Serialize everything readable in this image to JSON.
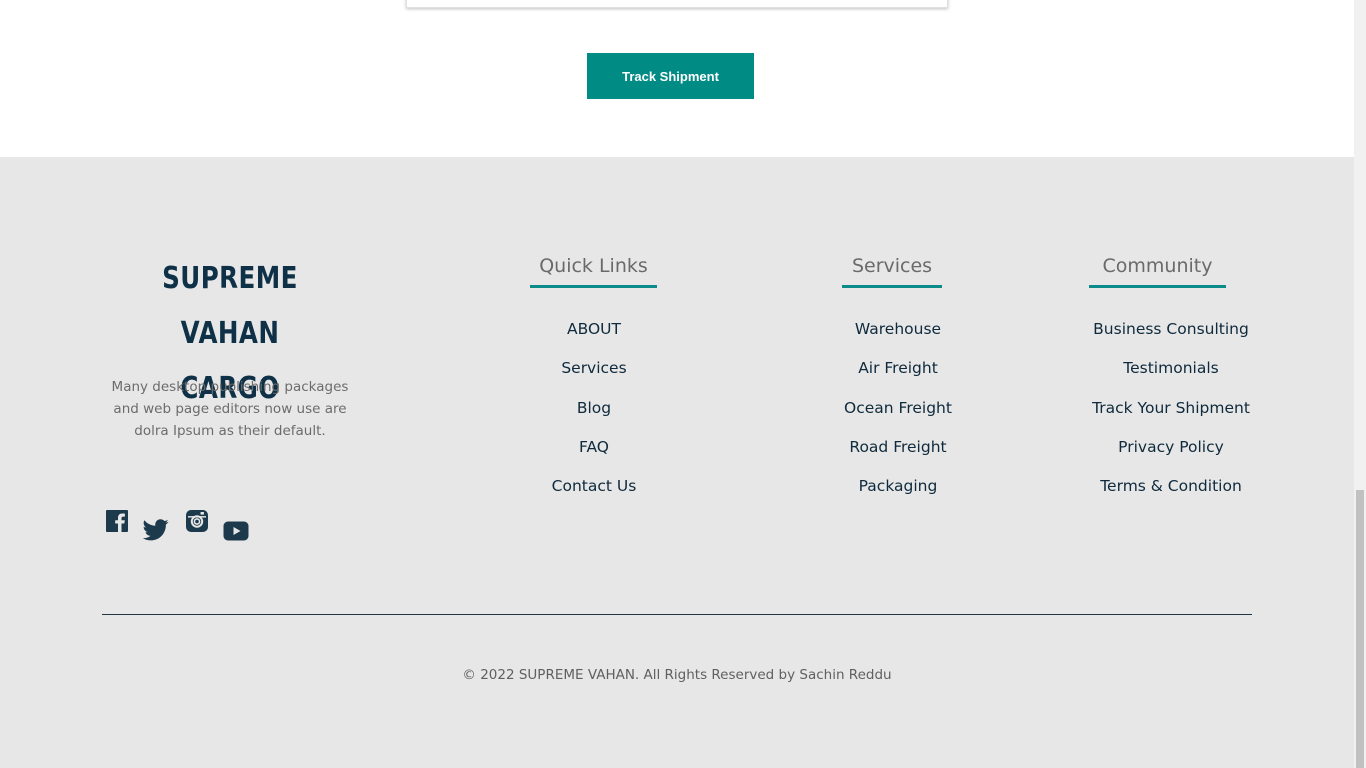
{
  "tracking": {
    "button_label": "Track Shipment"
  },
  "brand": {
    "name_line1": "SUPREME VAHAN",
    "name_line2": "CARGO",
    "description": "Many desktop publishing packages and web page editors now use are dolra Ipsum as their default."
  },
  "social": [
    {
      "icon": "facebook-icon"
    },
    {
      "icon": "twitter-icon"
    },
    {
      "icon": "instagram-icon"
    },
    {
      "icon": "youtube-icon"
    }
  ],
  "quick_links": {
    "heading": "Quick Links",
    "items": [
      "ABOUT",
      "Services",
      "Blog",
      "FAQ",
      "Contact Us"
    ]
  },
  "services": {
    "heading": "Services",
    "items": [
      "Warehouse",
      "Air Freight",
      "Ocean Freight",
      "Road Freight",
      "Packaging"
    ]
  },
  "community": {
    "heading": "Community",
    "items": [
      "Business Consulting",
      "Testimonials",
      "Track Your Shipment",
      "Privacy Policy",
      "Terms & Condition"
    ]
  },
  "footer": {
    "copyright": "© 2022 SUPREME VAHAN. All Rights Reserved by Sachin Reddu"
  },
  "colors": {
    "accent": "#008b84",
    "brand_text": "#0f3147",
    "footer_bg": "#e7e7e7"
  }
}
